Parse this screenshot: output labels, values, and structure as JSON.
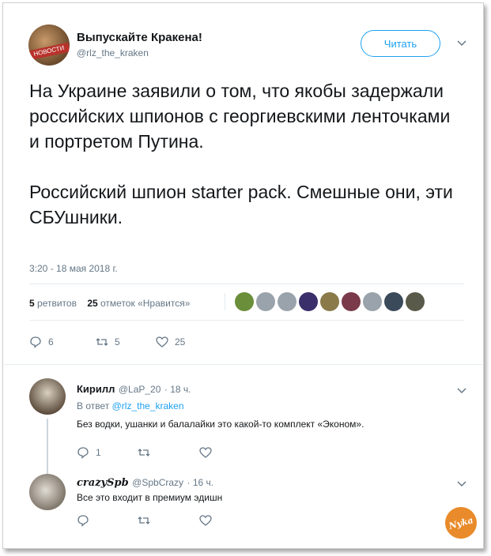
{
  "tweet": {
    "author_name": "Выпускайте Кракена!",
    "author_handle": "@rlz_the_kraken",
    "avatar_badge": "НОВОСТИ",
    "follow_label": "Читать",
    "text": "На Украине заявили о том, что якобы задержали российских шпионов с георгиевскими ленточками и портретом Путина.\n\nРоссийский шпион starter pack. Смешные они, эти СБУшники.",
    "timestamp": "3:20 - 18 мая 2018 г.",
    "retweets_count": "5",
    "retweets_label": "ретвитов",
    "likes_count": "25",
    "likes_label": "отметок «Нравится»",
    "likers": [
      "#6b8e3a",
      "#9aa3ab",
      "#9aa3ab",
      "#3a2f6b",
      "#8a7a4a",
      "#7a3a4a",
      "#9aa3ab",
      "#3a4a5a",
      "#5a5a4a"
    ],
    "actions": {
      "replies": "6",
      "retweets": "5",
      "likes": "25"
    }
  },
  "replies": [
    {
      "name": "Кирилл",
      "handle": "@LaP_20",
      "time": "· 18 ч.",
      "in_reply_prefix": "В ответ",
      "in_reply_handle": "@rlz_the_kraken",
      "text": "Без водки, ушанки и балалайки это какой-то комплект «Эконом».",
      "actions": {
        "replies": "1",
        "retweets": "",
        "likes": ""
      }
    },
    {
      "name": "crazySpb",
      "handle": "@SpbCrazy",
      "time": "· 16 ч.",
      "text": "Все это входит в премиум эдишн",
      "actions": {
        "replies": "",
        "retweets": "",
        "likes": ""
      }
    }
  ],
  "watermark": "Nyka",
  "colors": {
    "accent": "#1da1f2",
    "muted": "#657786",
    "text": "#14171a"
  }
}
